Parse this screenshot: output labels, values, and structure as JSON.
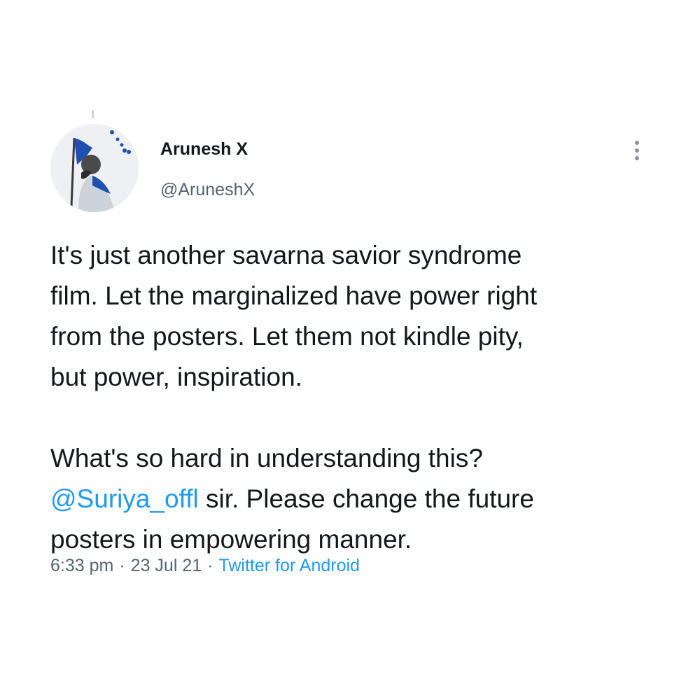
{
  "tweet": {
    "author": {
      "display_name": "Arunesh X",
      "handle": "@AruneshX"
    },
    "more_icon": "more-vertical-icon",
    "body": {
      "paragraph1": [
        "It's just another savarna savior syndrome",
        "film. Let the marginalized have power right",
        "from the posters. Let them not kindle pity,",
        "but power, inspiration."
      ],
      "paragraph2_line1": "What's so hard in understanding this?",
      "mention": "@Suriya_offl",
      "paragraph2_line2_rest": " sir. Please change the future",
      "paragraph2_line3": "posters in empowering manner."
    },
    "meta": {
      "time": "6:33 pm",
      "separator": "·",
      "date": "23 Jul 21",
      "source": "Twitter for Android"
    }
  },
  "colors": {
    "text": "#14171a",
    "secondary": "#536471",
    "link": "#1d9bf0",
    "flag": "#1f4fb0"
  }
}
